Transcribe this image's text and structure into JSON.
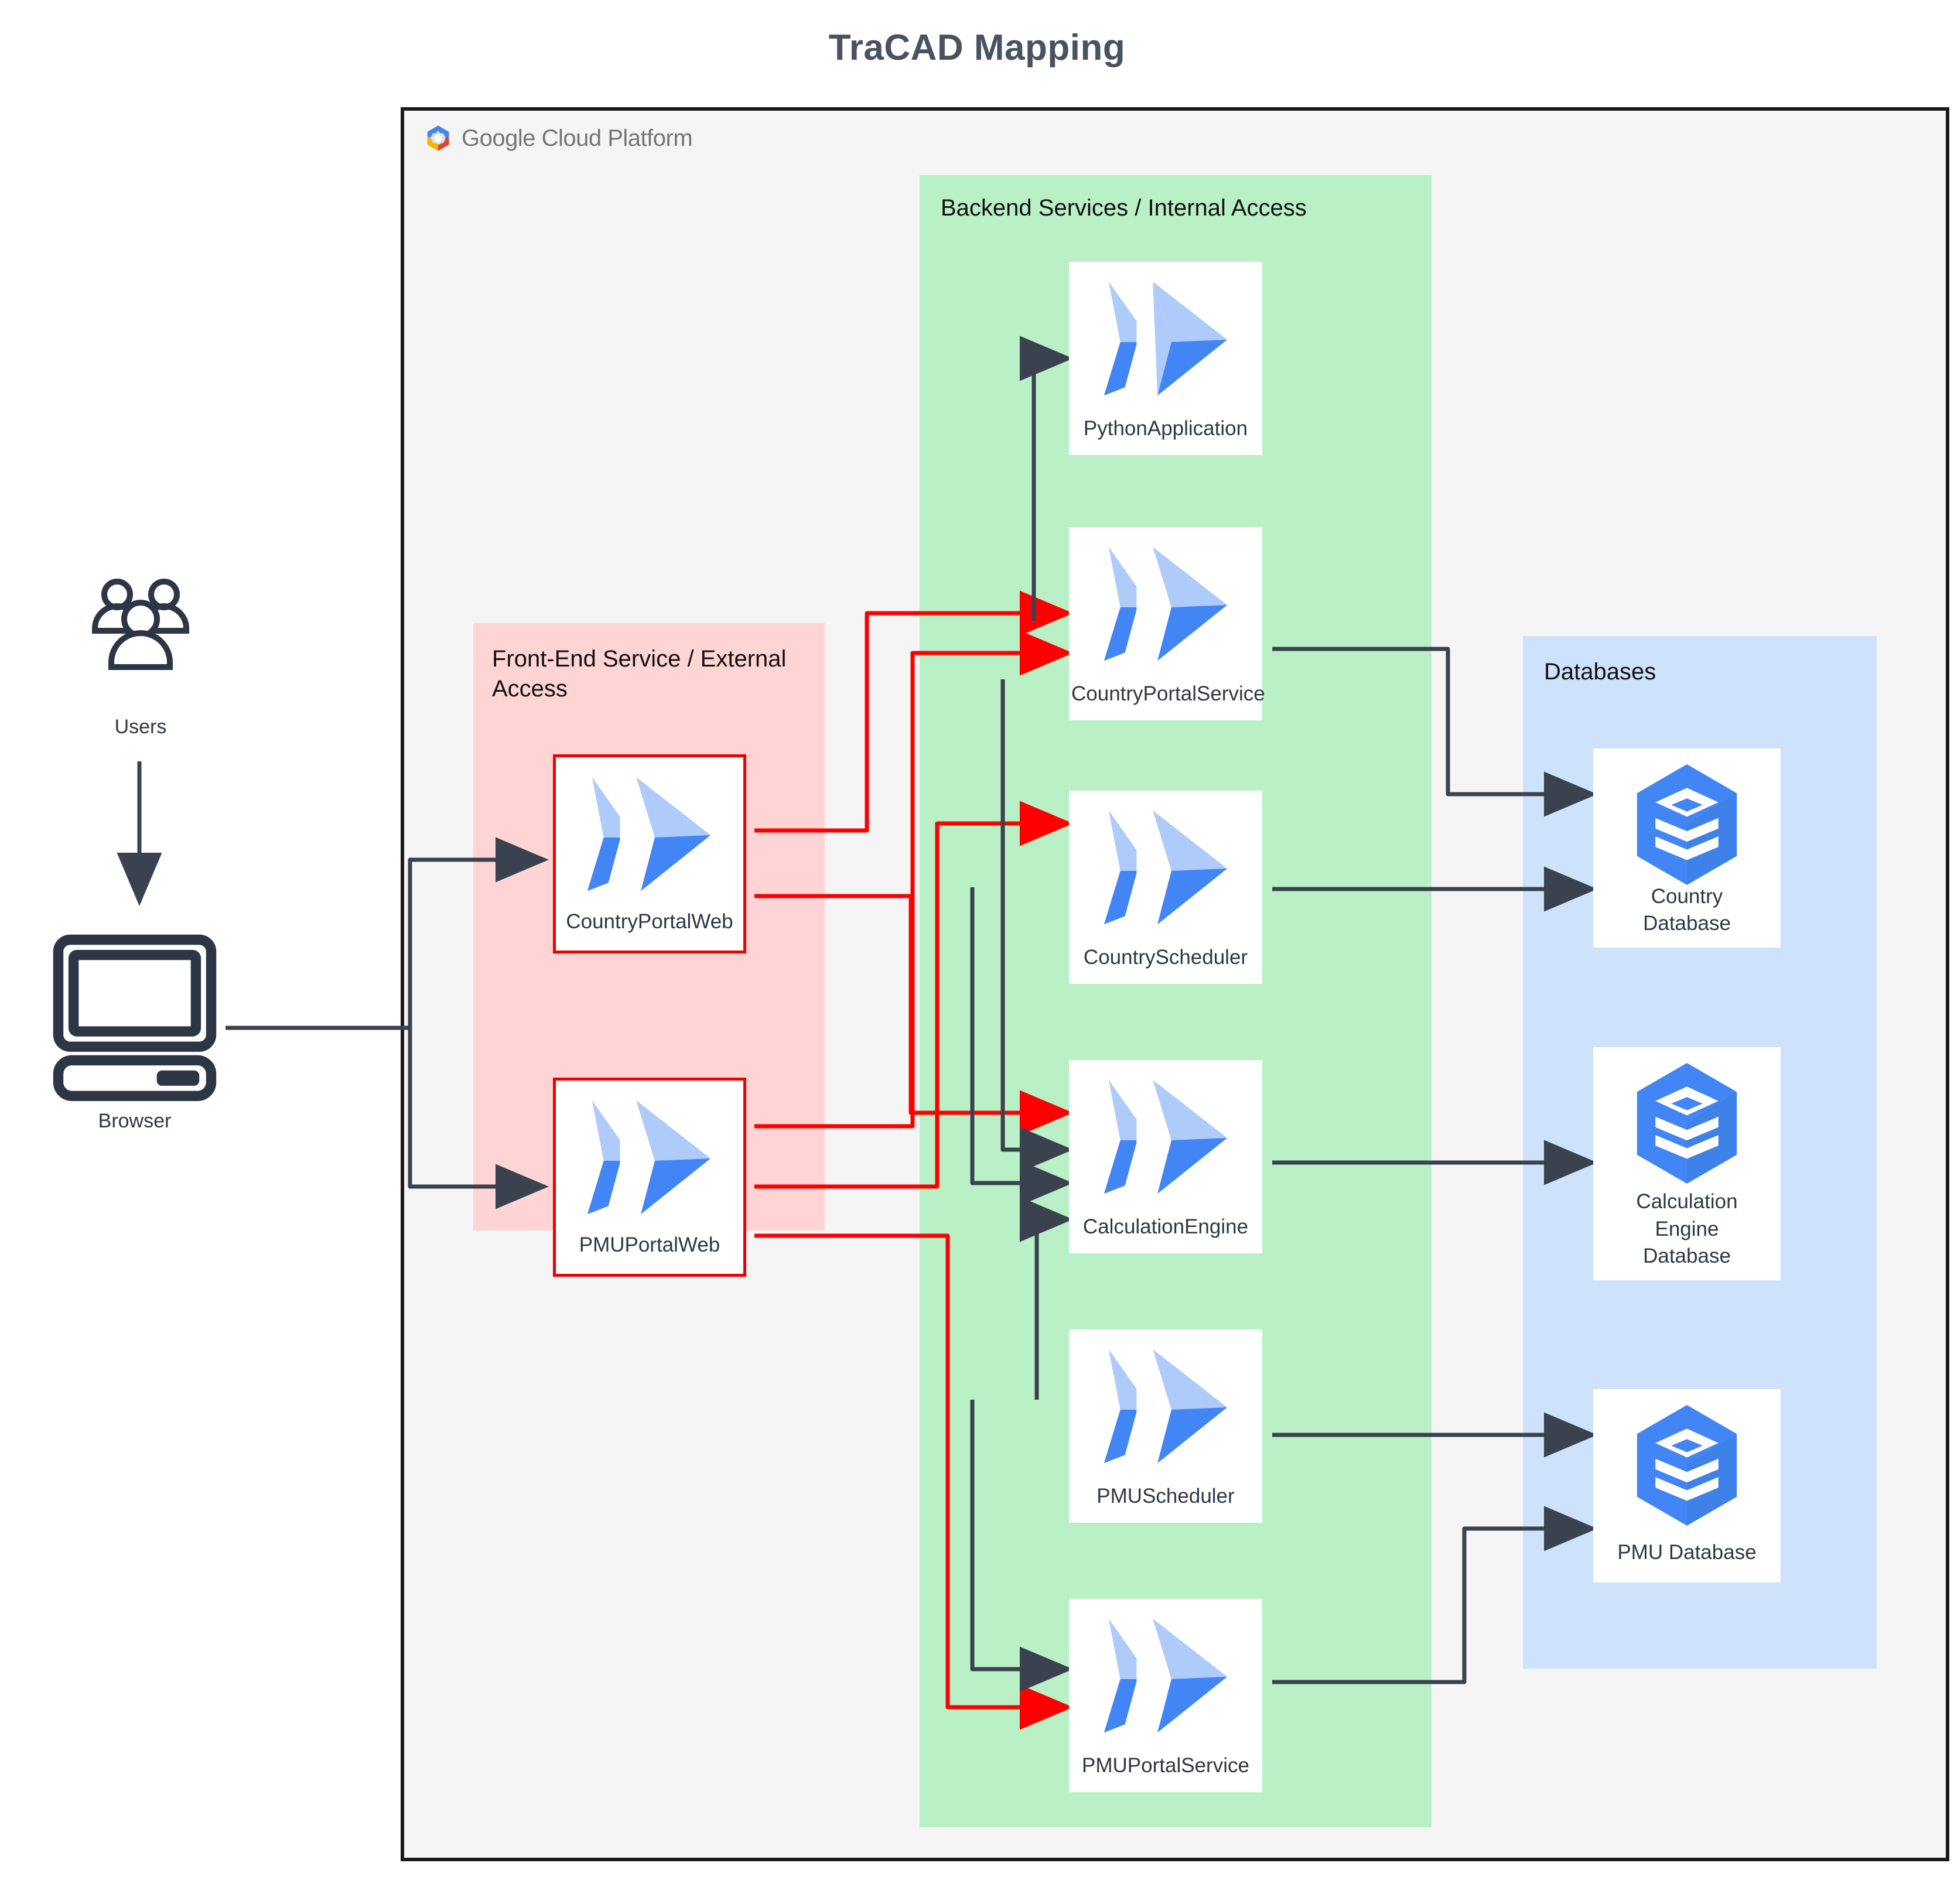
{
  "page": {
    "title": "TraCAD Mapping",
    "title_color": "#49525f",
    "background": "#ffffff"
  },
  "cloud": {
    "provider_name_primary": "Google",
    "provider_name_secondary": "Cloud Platform",
    "border_color": "#1a1a1a",
    "fill_color": "#f5f5f5"
  },
  "zones": [
    {
      "id": "backend",
      "label": "Backend Services / Internal Access",
      "color": "#b9f0c5"
    },
    {
      "id": "frontend",
      "label": "Front-End Service / External Access",
      "color": "#ffd4d4"
    },
    {
      "id": "databases",
      "label": "Databases",
      "color": "#cfe2fb"
    }
  ],
  "actors": [
    {
      "id": "users",
      "label": "Users",
      "icon": "users-icon"
    },
    {
      "id": "browser",
      "label": "Browser",
      "icon": "desktop-computer-icon"
    }
  ],
  "nodes": {
    "python_application": {
      "label": "PythonApplication",
      "icon": "cloud-run-icon",
      "zone": "backend",
      "highlight": false
    },
    "country_portal_service": {
      "label": "CountryPortalService",
      "icon": "cloud-run-icon",
      "zone": "backend",
      "highlight": false
    },
    "country_scheduler": {
      "label": "CountryScheduler",
      "icon": "cloud-run-icon",
      "zone": "backend",
      "highlight": false
    },
    "calculation_engine": {
      "label": "CalculationEngine",
      "icon": "cloud-run-icon",
      "zone": "backend",
      "highlight": false
    },
    "pmu_scheduler": {
      "label": "PMUScheduler",
      "icon": "cloud-run-icon",
      "zone": "backend",
      "highlight": false
    },
    "pmu_portal_service": {
      "label": "PMUPortalService",
      "icon": "cloud-run-icon",
      "zone": "backend",
      "highlight": false
    },
    "country_portal_web": {
      "label": "CountryPortalWeb",
      "icon": "cloud-run-icon",
      "zone": "frontend",
      "highlight": true
    },
    "pmu_portal_web": {
      "label": "PMUPortalWeb",
      "icon": "cloud-run-icon",
      "zone": "frontend",
      "highlight": true
    },
    "country_database": {
      "label_line1": "Country",
      "label_line2": "Database",
      "icon": "database-icon",
      "zone": "databases"
    },
    "calculation_engine_database": {
      "label_line1": "Calculation",
      "label_line2": "Engine",
      "label_line3": "Database",
      "icon": "database-icon",
      "zone": "databases"
    },
    "pmu_database": {
      "label_line1": "PMU Database",
      "icon": "database-icon",
      "zone": "databases"
    }
  },
  "edges": {
    "dark_color": "#3a4250",
    "red_color": "#ff0000",
    "links": [
      {
        "from": "users",
        "to": "browser",
        "style": "dark"
      },
      {
        "from": "browser",
        "to": "country_portal_web",
        "style": "dark"
      },
      {
        "from": "browser",
        "to": "pmu_portal_web",
        "style": "dark"
      },
      {
        "from": "country_portal_web",
        "to": "python_application_branch",
        "style": "red"
      },
      {
        "from": "country_portal_web",
        "to": "country_portal_service",
        "style": "red"
      },
      {
        "from": "country_portal_web",
        "to": "calculation_engine",
        "style": "red"
      },
      {
        "from": "pmu_portal_web",
        "to": "country_portal_service",
        "style": "red"
      },
      {
        "from": "pmu_portal_web",
        "to": "country_scheduler",
        "style": "red"
      },
      {
        "from": "pmu_portal_web",
        "to": "pmu_portal_service",
        "style": "red"
      },
      {
        "from": "country_portal_service",
        "to": "python_application",
        "style": "dark"
      },
      {
        "from": "country_portal_service",
        "to": "country_database",
        "style": "dark"
      },
      {
        "from": "country_portal_service",
        "to": "calculation_engine",
        "style": "dark"
      },
      {
        "from": "country_scheduler",
        "to": "country_database",
        "style": "dark"
      },
      {
        "from": "country_scheduler",
        "to": "calculation_engine",
        "style": "dark"
      },
      {
        "from": "calculation_engine",
        "to": "calculation_engine_database",
        "style": "dark"
      },
      {
        "from": "pmu_scheduler",
        "to": "pmu_database",
        "style": "dark"
      },
      {
        "from": "pmu_scheduler",
        "to": "calculation_engine",
        "style": "dark"
      },
      {
        "from": "pmu_portal_service",
        "to": "pmu_database",
        "style": "dark"
      },
      {
        "from": "pmu_portal_service_in",
        "to": "pmu_portal_service",
        "style": "dark"
      }
    ]
  },
  "icon_colors": {
    "cloud_run_light": "#aecbfa",
    "cloud_run_dark": "#4285f4",
    "database_hex": "#4285f4",
    "database_hex_shadow": "#3a78e7",
    "database_layers": "#ffffff",
    "actor_stroke": "#2c3644",
    "google_blue": "#4285f4",
    "google_red": "#db4437",
    "google_yellow": "#f4b400",
    "google_grey": "#757575"
  }
}
